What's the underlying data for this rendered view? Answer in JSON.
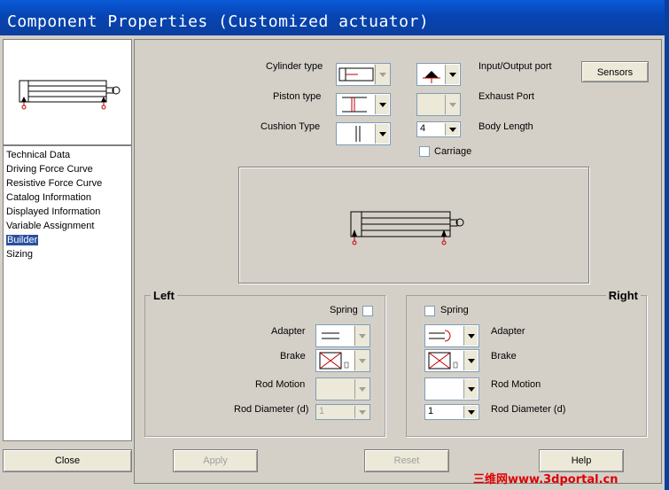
{
  "window": {
    "title": "Component Properties (Customized actuator)"
  },
  "nav": {
    "items": [
      "Technical Data",
      "Driving Force Curve",
      "Resistive Force Curve",
      "Catalog Information",
      "Displayed Information",
      "Variable Assignment",
      "Builder",
      "Sizing"
    ],
    "selected": "Builder"
  },
  "footer": {
    "close": "Close",
    "apply": "Apply",
    "reset": "Reset",
    "help": "Help"
  },
  "top": {
    "cylinder_type": "Cylinder type",
    "piston_type": "Piston type",
    "cushion_type": "Cushion Type",
    "io_port": "Input/Output port",
    "exhaust_port": "Exhaust Port",
    "body_length": "Body Length",
    "body_length_value": "4",
    "carriage": "Carriage",
    "sensors": "Sensors"
  },
  "left": {
    "title": "Left",
    "spring": "Spring",
    "adapter": "Adapter",
    "brake": "Brake",
    "rod_motion": "Rod Motion",
    "rod_diameter": "Rod Diameter (d)",
    "rod_diameter_value": "1"
  },
  "right": {
    "title": "Right",
    "spring": "Spring",
    "adapter": "Adapter",
    "brake": "Brake",
    "rod_motion": "Rod Motion",
    "rod_diameter": "Rod Diameter (d)",
    "rod_diameter_value": "1"
  },
  "watermark": "三维网www.3dportal.cn",
  "colors": {
    "title_bar": "#0744b4",
    "selection": "#2a4fa0",
    "port_red": "#c00000",
    "watermark": "#e00000"
  }
}
